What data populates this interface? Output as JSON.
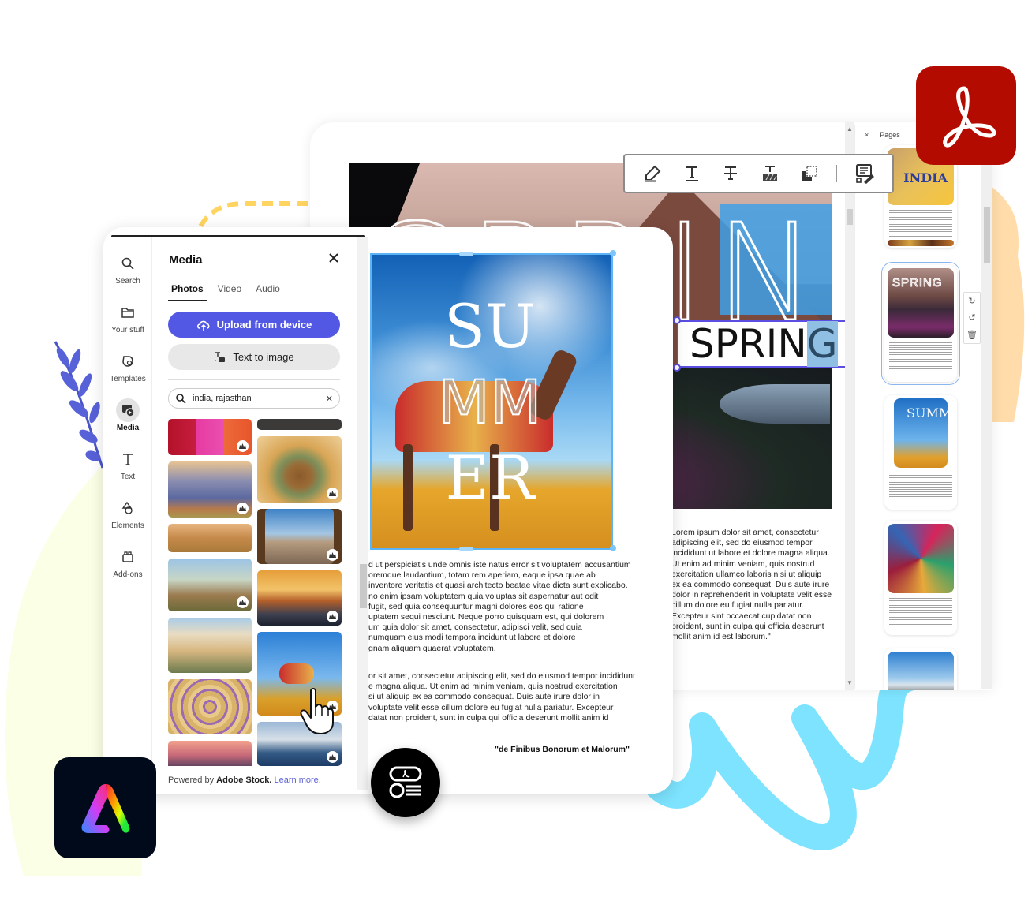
{
  "express": {
    "rail": [
      {
        "label": "Search",
        "icon": "search-icon"
      },
      {
        "label": "Your stuff",
        "icon": "folder-icon"
      },
      {
        "label": "Templates",
        "icon": "templates-icon"
      },
      {
        "label": "Media",
        "icon": "media-icon",
        "active": true
      },
      {
        "label": "Text",
        "icon": "text-icon"
      },
      {
        "label": "Elements",
        "icon": "elements-icon"
      },
      {
        "label": "Add-ons",
        "icon": "addons-icon"
      }
    ],
    "media_panel": {
      "title": "Media",
      "tabs": [
        {
          "label": "Photos",
          "active": true
        },
        {
          "label": "Video",
          "active": false
        },
        {
          "label": "Audio",
          "active": false
        }
      ],
      "upload_label": "Upload from device",
      "text_to_image_label": "Text to image",
      "search_value": "india, rajasthan",
      "photos": [
        {
          "subject": "colored powder piles",
          "premium": true
        },
        {
          "subject": "dark partial top",
          "premium": true
        },
        {
          "subject": "blue city fort wall",
          "premium": true
        },
        {
          "subject": "ornate palace doorway",
          "premium": true
        },
        {
          "subject": "desert fort panorama",
          "premium": false
        },
        {
          "subject": "arched window city view",
          "premium": true
        },
        {
          "subject": "fort on hill",
          "premium": true
        },
        {
          "subject": "chhatri at sunset",
          "premium": true
        },
        {
          "subject": "white palace",
          "premium": false
        },
        {
          "subject": "decorated camel in desert",
          "premium": true
        },
        {
          "subject": "patterned textile",
          "premium": false
        },
        {
          "subject": "lake palace",
          "premium": true
        },
        {
          "subject": "fort at dusk",
          "premium": false
        }
      ],
      "powered_prefix": "Powered by ",
      "powered_brand": "Adobe Stock.",
      "learn_more": "Learn more."
    },
    "canvas": {
      "summer_lines": [
        "SU",
        "MM",
        "ER"
      ],
      "paragraph1": "d ut perspiciatis unde omnis iste natus error sit voluptatem accusantium\noremque laudantium, totam rem aperiam, eaque ipsa quae ab\n inventore veritatis et quasi architecto beatae vitae dicta sunt explicabo.\nno enim ipsam voluptatem quia voluptas sit aspernatur aut odit\n fugit, sed quia consequuntur magni dolores eos qui ratione\nuptatem sequi nesciunt. Neque porro quisquam est, qui dolorem\num quia dolor sit amet, consectetur, adipisci velit, sed quia\n numquam eius modi tempora incidunt ut labore et dolore\ngnam aliquam quaerat voluptatem.",
      "paragraph2": "or sit amet, consectetur adipiscing elit, sed do eiusmod tempor incididunt\ne magna aliqua. Ut enim ad minim veniam, quis nostrud exercitation\nsi ut aliquip ex ea commodo consequat. Duis aute irure dolor in\nvoluptate velit esse cillum dolore eu fugiat nulla pariatur. Excepteur\ndatat non proident, sunt in culpa qui officia deserunt mollit anim id",
      "quote": "\"de Finibus Bonorum et Malorum\""
    }
  },
  "acrobat": {
    "spring_outline": "SPRING",
    "spring_text_plain": "SPRIN",
    "spring_text_highlight": "G",
    "column_text": "Lorem ipsum dolor sit amet, consectetur\nadipiscing elit, sed do eiusmod tempor\nincididunt ut labore et dolore magna aliqua.\nUt enim ad minim veniam, quis nostrud\nexercitation ullamco laboris nisi ut aliquip\nex ea commodo consequat. Duis aute irure\ndolor in reprehenderit in voluptate velit esse\ncillum dolore eu fugiat nulla pariatur.\nExcepteur sint occaecat cupidatat non\nproident, sunt in culpa qui officia deserunt\nmollit anim id est laborum.\"",
    "quick_toolbar": [
      {
        "icon": "highlight-icon",
        "tooltip": "Highlight"
      },
      {
        "icon": "underline-icon",
        "tooltip": "Underline"
      },
      {
        "icon": "strikethrough-icon",
        "tooltip": "Strikethrough"
      },
      {
        "icon": "replace-text-icon",
        "tooltip": "Replace text"
      },
      {
        "icon": "copy-icon",
        "tooltip": "Copy"
      },
      {
        "icon": "edit-text-icon",
        "tooltip": "Edit text"
      }
    ],
    "pages_panel": {
      "close_label": "×",
      "title": "Pages",
      "thumbnails": [
        {
          "label": "INDIA",
          "selected": false
        },
        {
          "label": "SPRING",
          "selected": true
        },
        {
          "label": "SUMMER",
          "selected": false
        },
        {
          "label": "textiles",
          "selected": false
        },
        {
          "label": "mountains",
          "selected": false
        }
      ],
      "actions": [
        "rotate-clockwise",
        "rotate-counterclockwise",
        "delete"
      ]
    }
  },
  "colors": {
    "express_primary": "#5258e4",
    "acrobat_red": "#b30b00",
    "selection_blue": "#5ab4f5",
    "textbox_purple": "#5b4ee0"
  }
}
